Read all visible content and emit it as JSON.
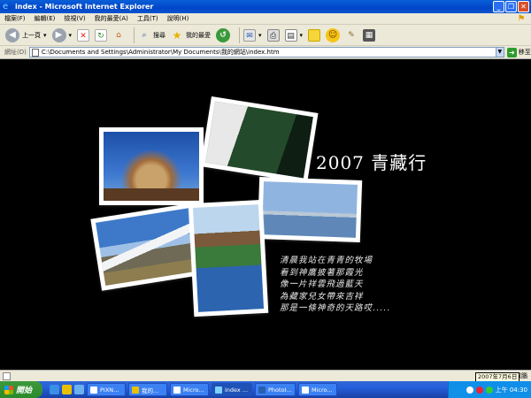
{
  "window": {
    "title": "index - Microsoft Internet Explorer",
    "buttons": [
      "_",
      "❐",
      "✕"
    ]
  },
  "menu": [
    "檔案(F)",
    "編輯(E)",
    "檢視(V)",
    "我的最愛(A)",
    "工具(T)",
    "說明(H)"
  ],
  "toolbar": {
    "back_label": "上一頁",
    "search_label": "搜尋",
    "favorites_label": "我的最愛"
  },
  "address": {
    "label": "網址(D)",
    "value": "C:\\Documents and Settings\\Administrator\\My Documents\\我的網站\\index.htm",
    "go_label": "移至"
  },
  "page": {
    "title": "2007  青藏行",
    "poem": [
      "清晨我站在青青的牧場",
      "看到神鷹披著那霞光",
      "像一片祥雲飛過藍天",
      "為藏家兒女帶來吉祥",
      "那是一條神奇的天路哎....."
    ]
  },
  "status": {
    "zone": "我的電腦"
  },
  "taskbar": {
    "start_label": "開始",
    "tasks": [
      "PIXN...",
      "我的...",
      "Micro...",
      "index ...",
      "PhotoI...",
      "Micro..."
    ],
    "clock": "上午 04:30",
    "tooltip": "2007年7月6日"
  },
  "colors": {
    "titlebar": "#0a5fd8",
    "chrome": "#ece9d8",
    "page_background": "#000000",
    "taskbar": "#245edb",
    "start": "#2b8a2b"
  }
}
